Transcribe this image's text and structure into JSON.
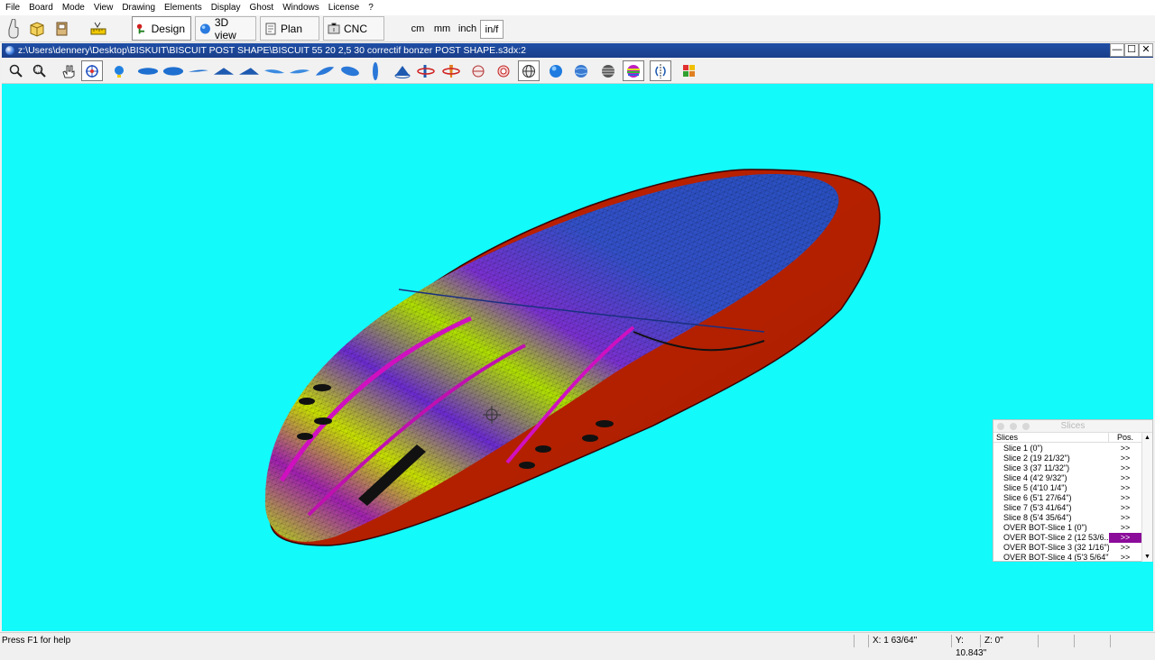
{
  "menu": [
    "File",
    "Board",
    "Mode",
    "View",
    "Drawing",
    "Elements",
    "Display",
    "Ghost",
    "Windows",
    "License",
    "?"
  ],
  "modes": {
    "design": "Design",
    "view3d": "3D view",
    "plan": "Plan",
    "cnc": "CNC"
  },
  "units": {
    "cm": "cm",
    "mm": "mm",
    "inch": "inch",
    "inf": "in/f"
  },
  "document": {
    "title": "z:\\Users\\dennery\\Desktop\\BISKUIT\\BISCUIT POST SHAPE\\BISCUIT 55 20 2,5 30 correctif bonzer POST SHAPE.s3dx:2"
  },
  "window_controls": {
    "minimize": "—",
    "maximize": "☐",
    "close": "✕"
  },
  "slices_panel": {
    "title": "Slices",
    "col_slices": "Slices",
    "col_pos": "Pos.",
    "rows": [
      {
        "name": "Slice 1 (0\")",
        "pos": ">>"
      },
      {
        "name": "Slice 2 (19 21/32\")",
        "pos": ">>"
      },
      {
        "name": "Slice 3 (37 11/32\")",
        "pos": ">>"
      },
      {
        "name": "Slice 4 (4'2 9/32\")",
        "pos": ">>"
      },
      {
        "name": "Slice 5 (4'10 1/4\")",
        "pos": ">>"
      },
      {
        "name": "Slice 6 (5'1 27/64\")",
        "pos": ">>"
      },
      {
        "name": "Slice 7 (5'3 41/64\")",
        "pos": ">>"
      },
      {
        "name": "Slice 8 (5'4 35/64\")",
        "pos": ">>"
      },
      {
        "name": "OVER BOT-Slice 1 (0\")",
        "pos": ">>"
      },
      {
        "name": "OVER BOT-Slice 2 (12 53/6...",
        "pos": ">>",
        "selected": true
      },
      {
        "name": "OVER BOT-Slice 3 (32 1/16\")",
        "pos": ">>"
      },
      {
        "name": "OVER BOT-Slice 4 (5'3 5/64\")",
        "pos": ">>"
      }
    ]
  },
  "status": {
    "help": "Press F1 for help",
    "x": "X: 1 63/64\"",
    "y": "Y: 10.843\"",
    "z": "Z: 0\""
  },
  "colors": {
    "viewport_bg": "#12fafa",
    "title_bar": "#1f4fa6",
    "selected_pos": "#8b0b9a"
  }
}
